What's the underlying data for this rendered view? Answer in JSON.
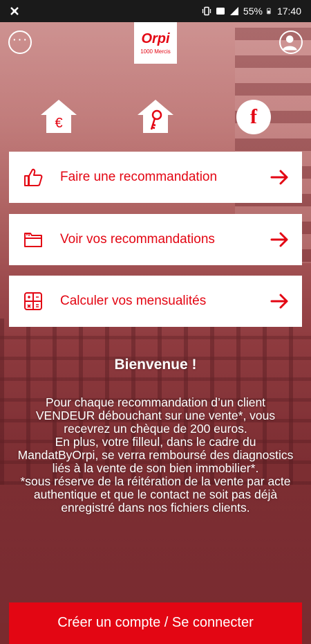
{
  "status_bar": {
    "battery": "55%",
    "time": "17:40"
  },
  "header": {
    "logo_text": "Orpi",
    "logo_subtext": "1000 Mercis"
  },
  "quick_icons": {
    "euro_house_icon": "euro-house-icon",
    "key_house_icon": "key-house-icon",
    "facebook_letter": "f"
  },
  "actions": [
    {
      "label": "Faire une recommandation",
      "icon": "thumbs-up-icon"
    },
    {
      "label": "Voir vos recommandations",
      "icon": "folder-icon"
    },
    {
      "label": "Calculer vos mensualités",
      "icon": "calculator-icon"
    }
  ],
  "welcome": {
    "title": "Bienvenue !",
    "paragraph_1": "Pour chaque recommandation d’un client VENDEUR débouchant sur une vente*, vous recevrez un chèque de 200 euros.",
    "paragraph_2": "En plus, votre filleul, dans le cadre du MandatByOrpi, se verra remboursé des diagnostics liés à la vente de son bien immobilier*.",
    "paragraph_3": "*sous réserve de la réitération de la vente par acte authentique et que le contact ne soit pas déjà enregistré dans nos fichiers clients."
  },
  "cta": {
    "label": "Créer un compte / Se connecter"
  },
  "colors": {
    "brand_red": "#e30613",
    "white": "#ffffff"
  }
}
